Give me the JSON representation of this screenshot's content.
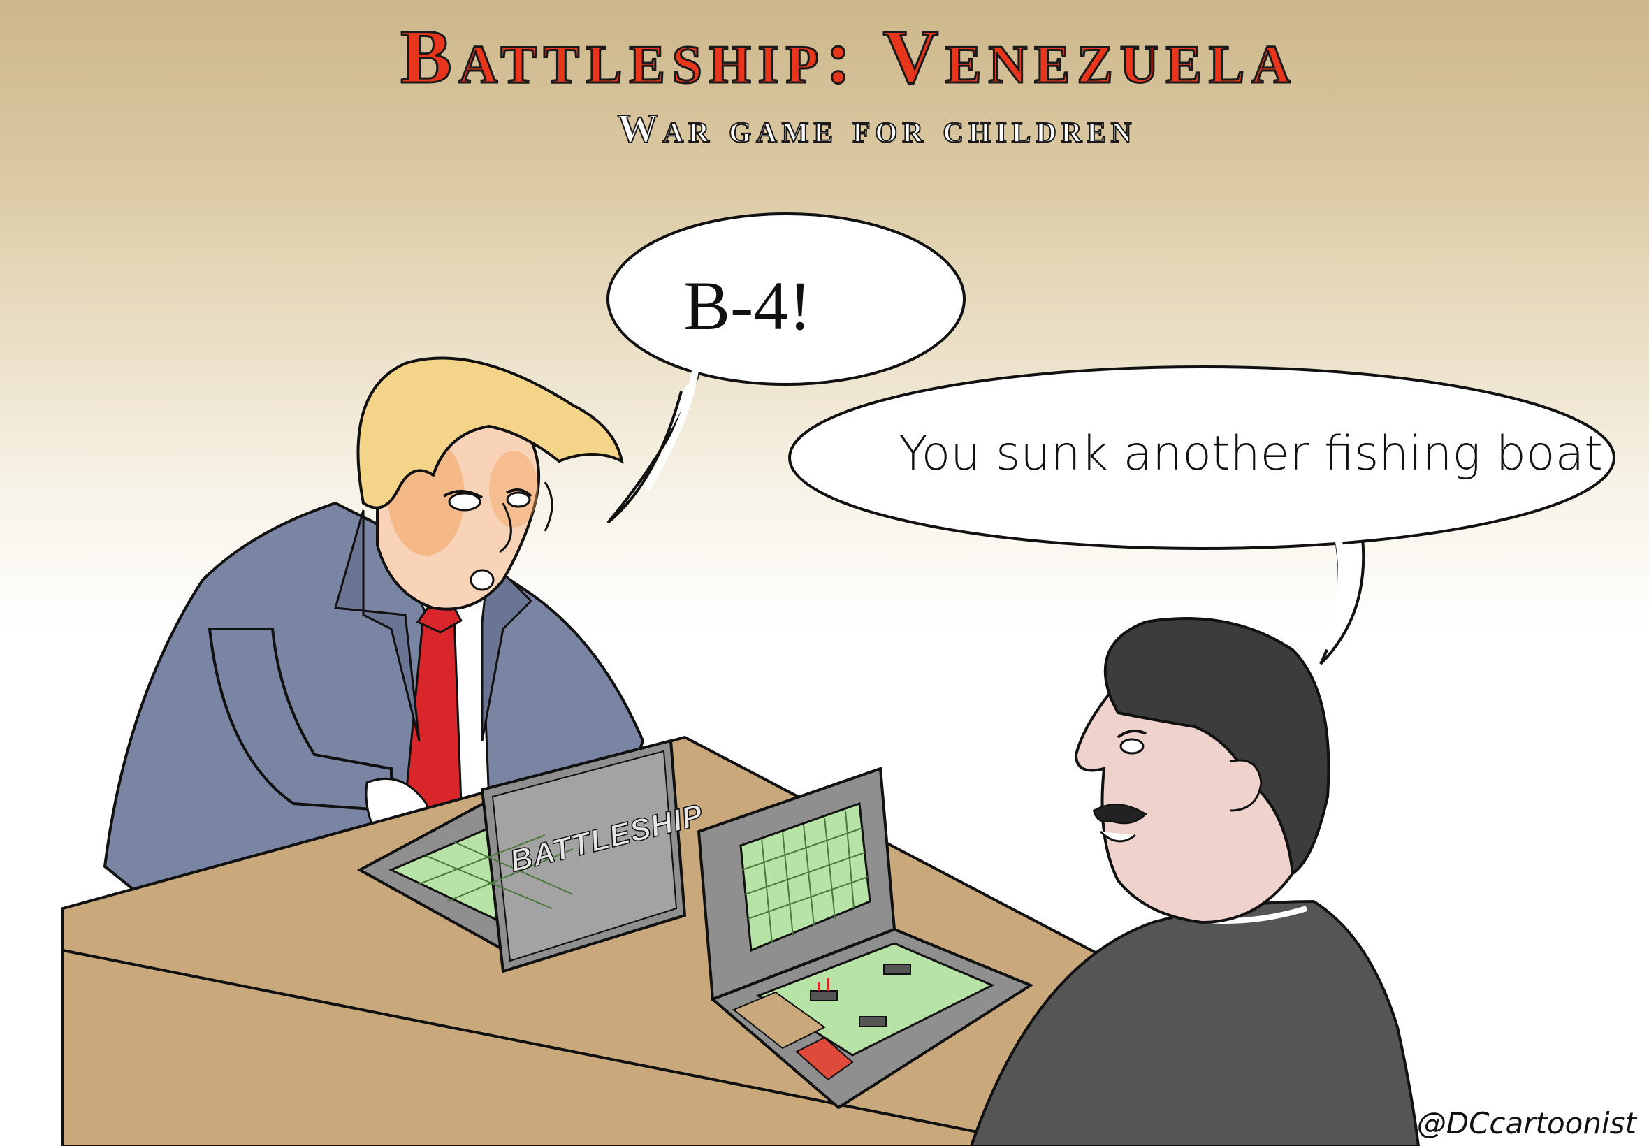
{
  "cartoon": {
    "title": "Battleship: Venezuela",
    "subtitle": "War game for children",
    "speech_left": "B-4!",
    "speech_right": "You sunk another fishing boat",
    "board_brand": "BATTLESHIP",
    "credit": "@DCcartoonist"
  },
  "colors": {
    "title_red": "#e8361c",
    "suit_blue": "#7a84a3",
    "tie_red": "#d8262a",
    "hair_yellow": "#f3d488",
    "table_brown": "#c9a87c",
    "board_gray": "#8f8f8f",
    "grid_green": "#b7e4a6",
    "sweater_gray": "#555555"
  }
}
